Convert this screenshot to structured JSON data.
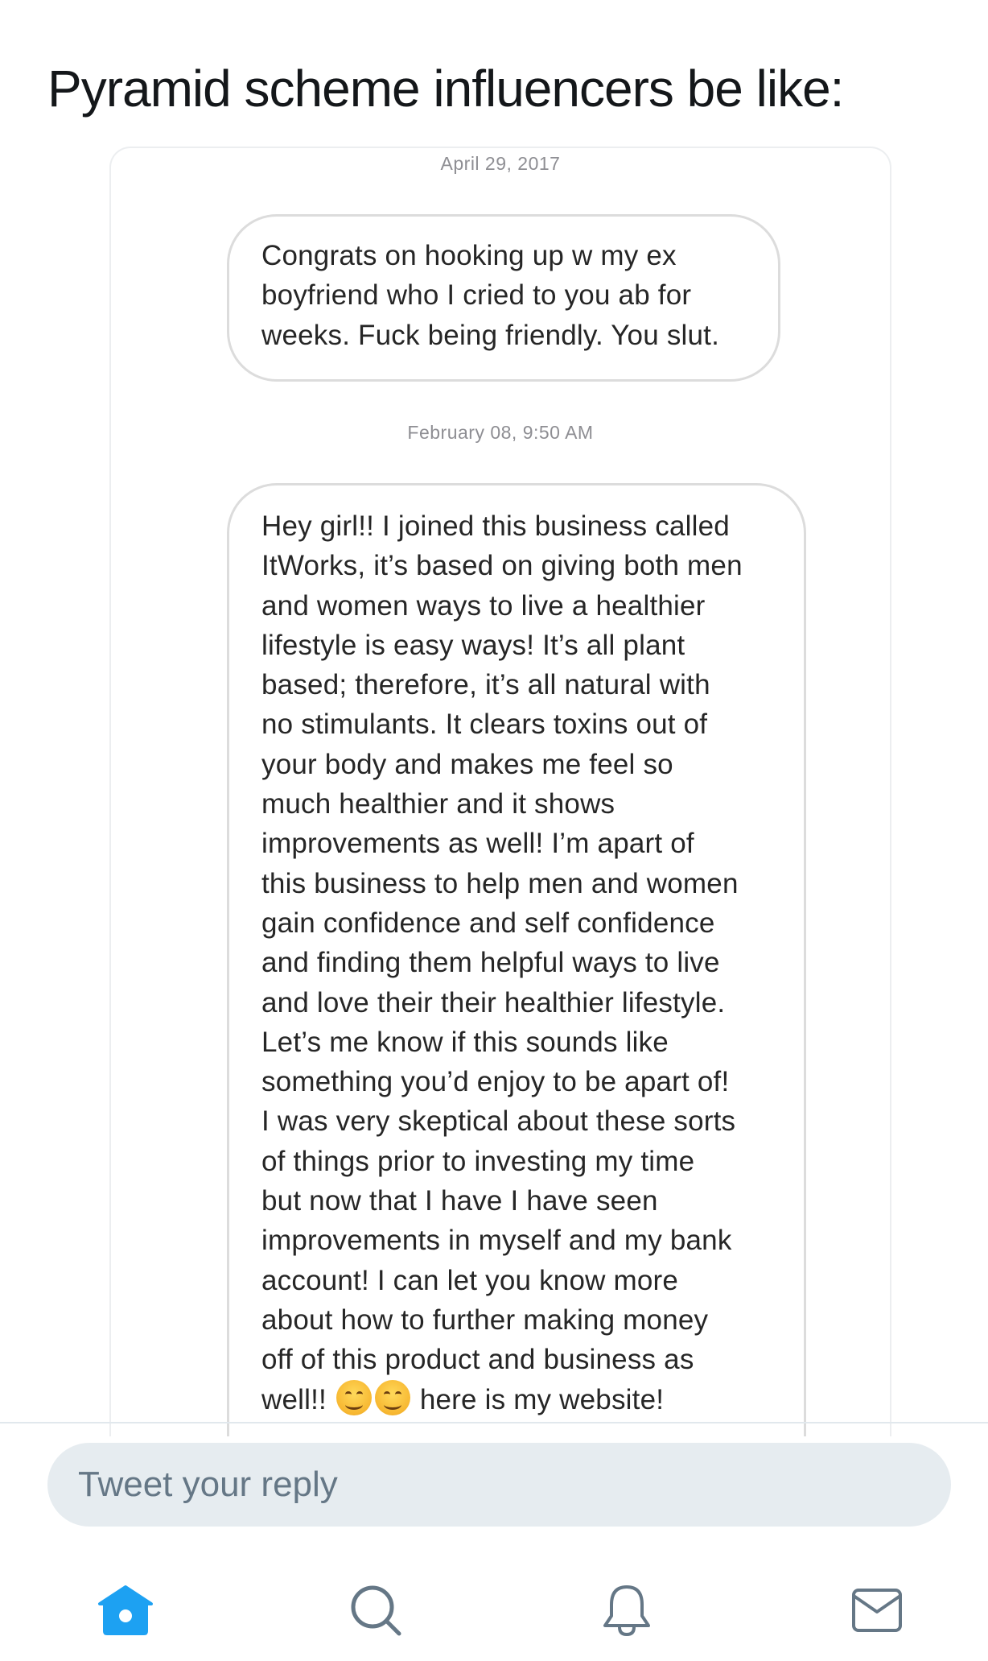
{
  "tweet": {
    "text": "Pyramid scheme influencers be like:"
  },
  "conversation": {
    "date_1": "April 29, 2017",
    "message_1": "Congrats on hooking up w my ex\nboyfriend who I cried to you ab for\nweeks. Fuck being friendly. You slut.",
    "date_2": "February 08, 9:50 AM",
    "message_2_body": "Hey girl!! I joined this business called\nItWorks, it’s based on giving both men\nand women ways to live a healthier\nlifestyle is easy ways! It’s all plant\nbased; therefore, it’s all natural with\nno stimulants. It clears toxins out of\nyour body and makes me feel so\nmuch healthier and it shows\nimprovements as well! I’m apart of\nthis business to help men and women\ngain confidence and self confidence\nand finding them helpful ways to live\nand love their their healthier lifestyle.\nLet’s me know if this sounds like\nsomething you’d enjoy to be apart of!\nI was very skeptical about these sorts\nof things prior to investing my time\nbut now that I have I have seen\nimprovements in myself and my bank\naccount! I can let you know more\nabout how to further making money\noff of this product and business as",
    "message_2_tail_start": "well!!",
    "message_2_tail_end": " here is my website!",
    "emoji_icon": "smiling-face-with-smiling-eyes"
  },
  "reply": {
    "placeholder": "Tweet your reply"
  },
  "tab_bar": {
    "items": [
      {
        "name": "home",
        "icon": "home-icon",
        "active": true
      },
      {
        "name": "search",
        "icon": "search-icon",
        "active": false
      },
      {
        "name": "notifications",
        "icon": "bell-icon",
        "active": false
      },
      {
        "name": "messages",
        "icon": "envelope-icon",
        "active": false
      }
    ]
  },
  "colors": {
    "accent": "#1da1f2",
    "icon_inactive": "#657786",
    "reply_bg": "#e6ecf0",
    "bubble_border": "#dcdcdc"
  }
}
